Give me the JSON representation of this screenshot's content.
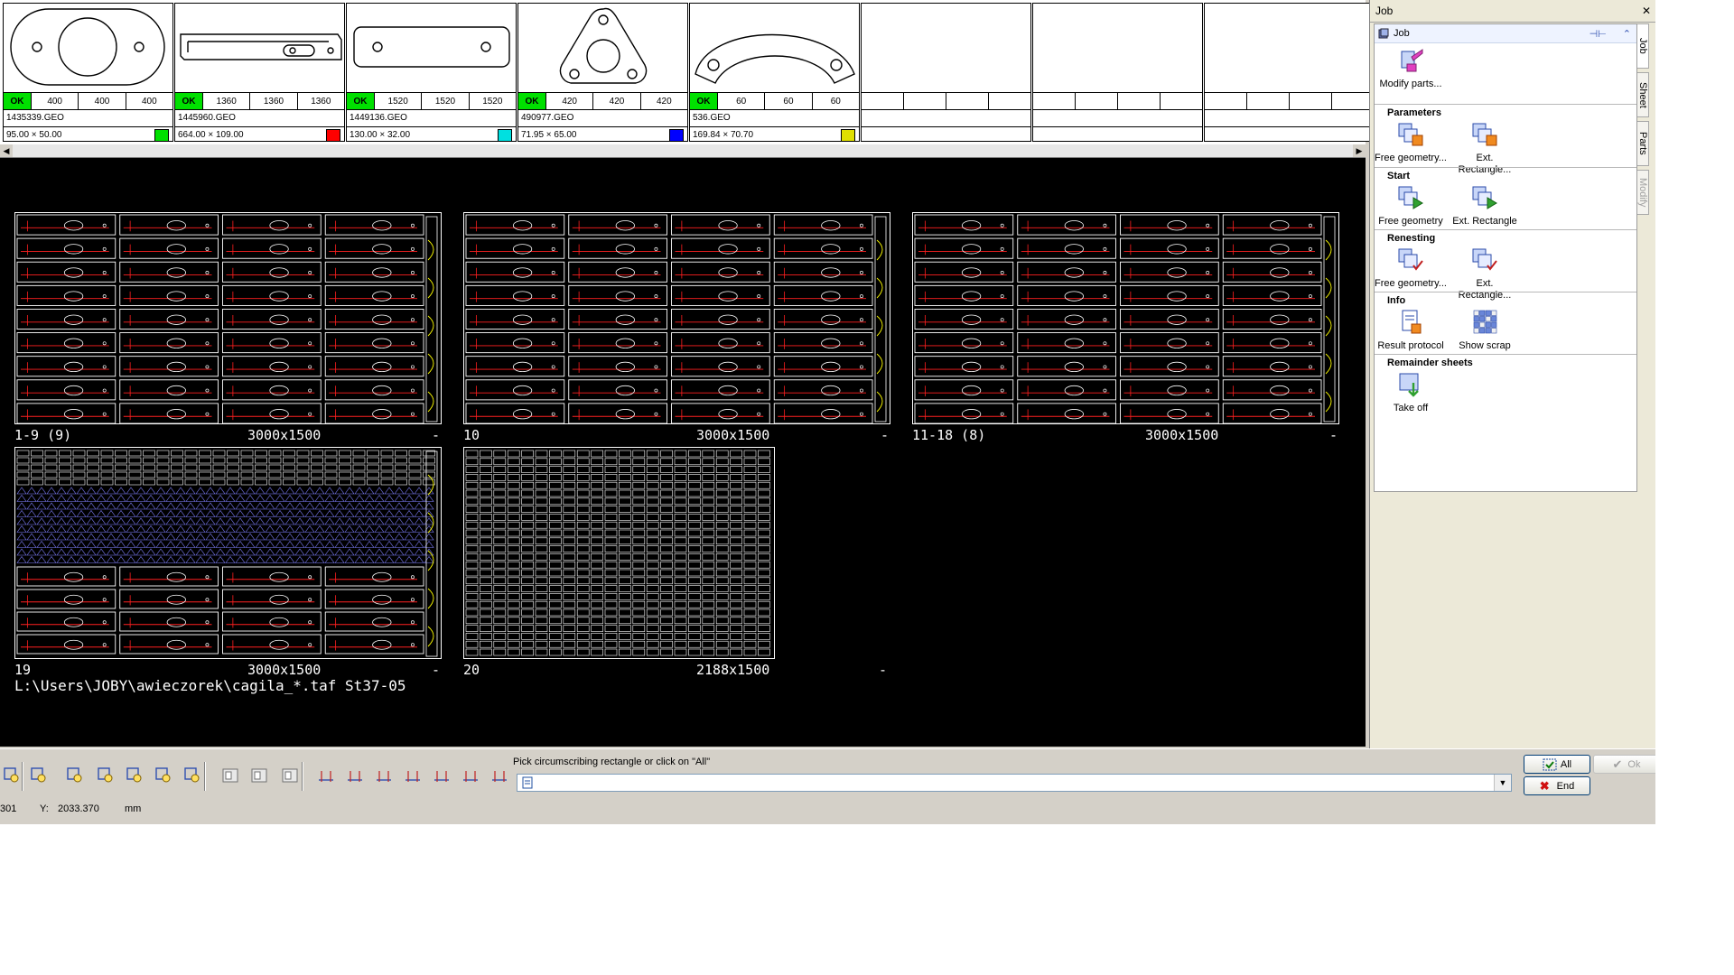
{
  "parts": [
    {
      "ok": "OK",
      "qty": [
        "400",
        "400",
        "400"
      ],
      "name": "1435339.GEO",
      "dims": "95.00 × 50.00",
      "color": "#00e000",
      "shape": "oval"
    },
    {
      "ok": "OK",
      "qty": [
        "1360",
        "1360",
        "1360"
      ],
      "name": "1445960.GEO",
      "dims": "664.00 × 109.00",
      "color": "#ff0000",
      "shape": "bar"
    },
    {
      "ok": "OK",
      "qty": [
        "1520",
        "1520",
        "1520"
      ],
      "name": "1449136.GEO",
      "dims": "130.00 × 32.00",
      "color": "#00e0e0",
      "shape": "plate"
    },
    {
      "ok": "OK",
      "qty": [
        "420",
        "420",
        "420"
      ],
      "name": "490977.GEO",
      "dims": "71.95 × 65.00",
      "color": "#0000ff",
      "shape": "triangle"
    },
    {
      "ok": "OK",
      "qty": [
        "60",
        "60",
        "60"
      ],
      "name": "536.GEO",
      "dims": "169.84 × 70.70",
      "color": "#e0e000",
      "shape": "arc"
    }
  ],
  "empty_tile_count": 3,
  "sheets": [
    {
      "id": "1-9 (9)",
      "size": "3000x1500",
      "dash": "-",
      "pattern": "bars"
    },
    {
      "id": "10",
      "size": "3000x1500",
      "dash": "-",
      "pattern": "bars"
    },
    {
      "id": "11-18 (8)",
      "size": "3000x1500",
      "dash": "-",
      "pattern": "bars"
    },
    {
      "id": "19",
      "size": "3000x1500",
      "dash": "-",
      "pattern": "mixed"
    },
    {
      "id": "20",
      "size": "2188x1500",
      "dash": "-",
      "pattern": "dense"
    }
  ],
  "canvas_path": "L:\\Users\\JOBY\\awieczorek\\cagila_*.taf St37-05",
  "side_panel": {
    "title": "Job",
    "close": "✕",
    "card_title": "Job",
    "sections": [
      {
        "title": "",
        "tools": [
          {
            "label": "Modify parts...",
            "icon": "modify-parts-icon"
          }
        ]
      },
      {
        "title": "Parameters",
        "tools": [
          {
            "label": "Free geometry...",
            "icon": "free-geometry-params-icon"
          },
          {
            "label": "Ext. Rectangle...",
            "icon": "ext-rectangle-params-icon"
          }
        ]
      },
      {
        "title": "Start",
        "tools": [
          {
            "label": "Free geometry",
            "icon": "free-geometry-start-icon"
          },
          {
            "label": "Ext. Rectangle",
            "icon": "ext-rectangle-start-icon"
          }
        ]
      },
      {
        "title": "Renesting",
        "tools": [
          {
            "label": "Free geometry...",
            "icon": "free-geometry-renest-icon"
          },
          {
            "label": "Ext. Rectangle...",
            "icon": "ext-rectangle-renest-icon"
          }
        ]
      },
      {
        "title": "Info",
        "tools": [
          {
            "label": "Result protocol",
            "icon": "result-protocol-icon"
          },
          {
            "label": "Show scrap",
            "icon": "show-scrap-icon"
          }
        ]
      },
      {
        "title": "Remainder sheets",
        "tools": [
          {
            "label": "Take off",
            "icon": "take-off-icon"
          }
        ]
      }
    ],
    "tabs": [
      {
        "label": "Job",
        "state": "active"
      },
      {
        "label": "Sheet",
        "state": "normal"
      },
      {
        "label": "Parts",
        "state": "normal"
      },
      {
        "label": "Modify",
        "state": "disabled"
      }
    ]
  },
  "bottom": {
    "prompt": "Pick circumscribing rectangle or click on \"All\"",
    "command_value": "",
    "all_label": "All",
    "ok_label": "Ok",
    "end_label": "End",
    "status_x": "301",
    "status_y_label": "Y:",
    "status_y": "2033.370",
    "status_unit": "mm"
  },
  "colors": {
    "canvas": "#000000",
    "part_red": "#ff2020",
    "ok_green": "#00e000",
    "sheet_outline": "#ffffff",
    "selection_yellow": "#ffff00"
  }
}
